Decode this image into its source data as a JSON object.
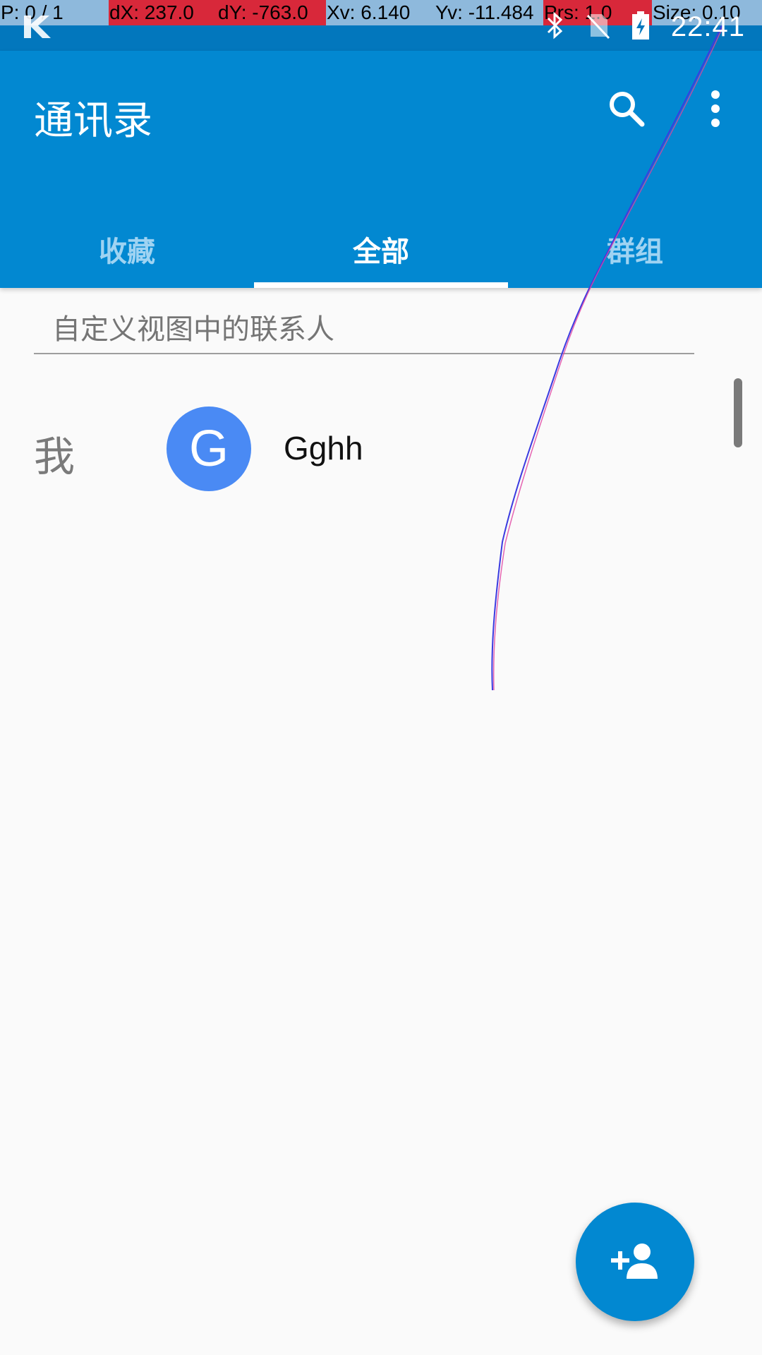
{
  "debug_overlay": {
    "pointer": "P: 0 / 1",
    "dx": "dX: 237.0",
    "dy": "dY: -763.0",
    "xv": "Xv: 6.140",
    "yv": "Yv: -11.484",
    "prs": "Prs: 1.0",
    "size": "Size: 0.10"
  },
  "status_bar": {
    "time": "22:41",
    "icons": [
      "notification-k-icon",
      "bluetooth-icon",
      "no-sim-icon",
      "battery-charging-icon"
    ]
  },
  "app_bar": {
    "title": "通讯录",
    "actions": [
      "search-icon",
      "more-vert-icon"
    ]
  },
  "tabs": [
    {
      "label": "收藏",
      "active": false
    },
    {
      "label": "全部",
      "active": true
    },
    {
      "label": "群组",
      "active": false
    }
  ],
  "list": {
    "filter_header": "自定义视图中的联系人",
    "me_section_label": "我",
    "contacts": [
      {
        "initial": "G",
        "name": "Gghh",
        "avatar_color": "#4A8AF4"
      }
    ]
  },
  "fab": {
    "icon": "add-person-icon"
  },
  "colors": {
    "primary": "#0288D1",
    "primary_dark": "#0277BD",
    "background": "#FAFAFA"
  }
}
